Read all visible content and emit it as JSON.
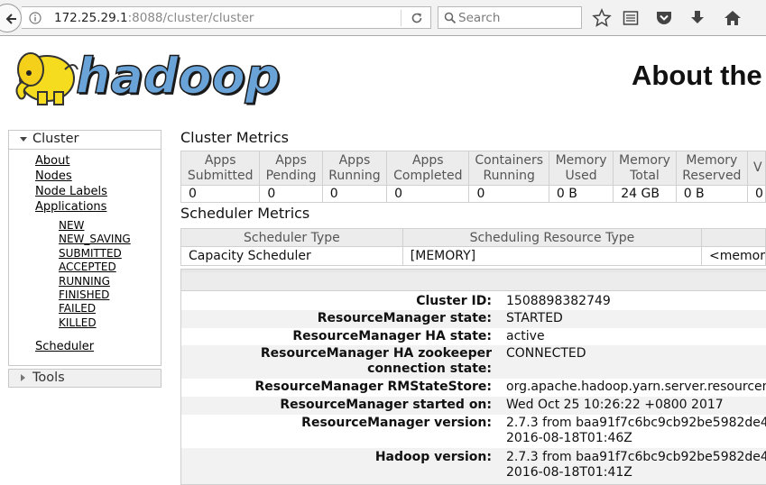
{
  "browser": {
    "url_host": "172.25.29.1",
    "url_rest": ":8088/cluster/cluster",
    "search_placeholder": "Search",
    "icons": [
      "back-icon",
      "info-icon",
      "reload-icon",
      "search-icon",
      "star-icon",
      "reader-icon",
      "pocket-icon",
      "download-icon",
      "home-icon"
    ]
  },
  "page": {
    "title": "About the",
    "logo_text": "hadoop"
  },
  "nav": {
    "cluster_label": "Cluster",
    "links": [
      "About",
      "Nodes",
      "Node Labels",
      "Applications"
    ],
    "app_states": [
      "NEW",
      "NEW_SAVING",
      "SUBMITTED",
      "ACCEPTED",
      "RUNNING",
      "FINISHED",
      "FAILED",
      "KILLED"
    ],
    "scheduler": "Scheduler",
    "tools_label": "Tools"
  },
  "cluster_metrics": {
    "title": "Cluster Metrics",
    "headers": [
      [
        "Apps",
        "Submitted"
      ],
      [
        "Apps",
        "Pending"
      ],
      [
        "Apps",
        "Running"
      ],
      [
        "Apps",
        "Completed"
      ],
      [
        "Containers",
        "Running"
      ],
      [
        "Memory",
        "Used"
      ],
      [
        "Memory",
        "Total"
      ],
      [
        "Memory",
        "Reserved"
      ],
      [
        "V",
        ""
      ]
    ],
    "values": [
      "0",
      "0",
      "0",
      "0",
      "0",
      "0 B",
      "24 GB",
      "0 B",
      "0"
    ]
  },
  "scheduler_metrics": {
    "title": "Scheduler Metrics",
    "headers": [
      "Scheduler Type",
      "Scheduling Resource Type",
      ""
    ],
    "values": [
      "Capacity Scheduler",
      "[MEMORY]",
      "<memor"
    ]
  },
  "cluster_info": [
    {
      "key": "Cluster ID:",
      "value": "1508898382749"
    },
    {
      "key": "ResourceManager state:",
      "value": "STARTED"
    },
    {
      "key": "ResourceManager HA state:",
      "value": "active"
    },
    {
      "key": "ResourceManager HA zookeeper connection state:",
      "value": "CONNECTED"
    },
    {
      "key": "ResourceManager RMStateStore:",
      "value": "org.apache.hadoop.yarn.server.resourcem"
    },
    {
      "key": "ResourceManager started on:",
      "value": "Wed Oct 25 10:26:22 +0800 2017"
    },
    {
      "key": "ResourceManager version:",
      "value": "2.7.3 from baa91f7c6bc9cb92be5982de4",
      "value2": "2016-08-18T01:46Z"
    },
    {
      "key": "Hadoop version:",
      "value": "2.7.3 from baa91f7c6bc9cb92be5982de4",
      "value2": "2016-08-18T01:41Z"
    }
  ]
}
